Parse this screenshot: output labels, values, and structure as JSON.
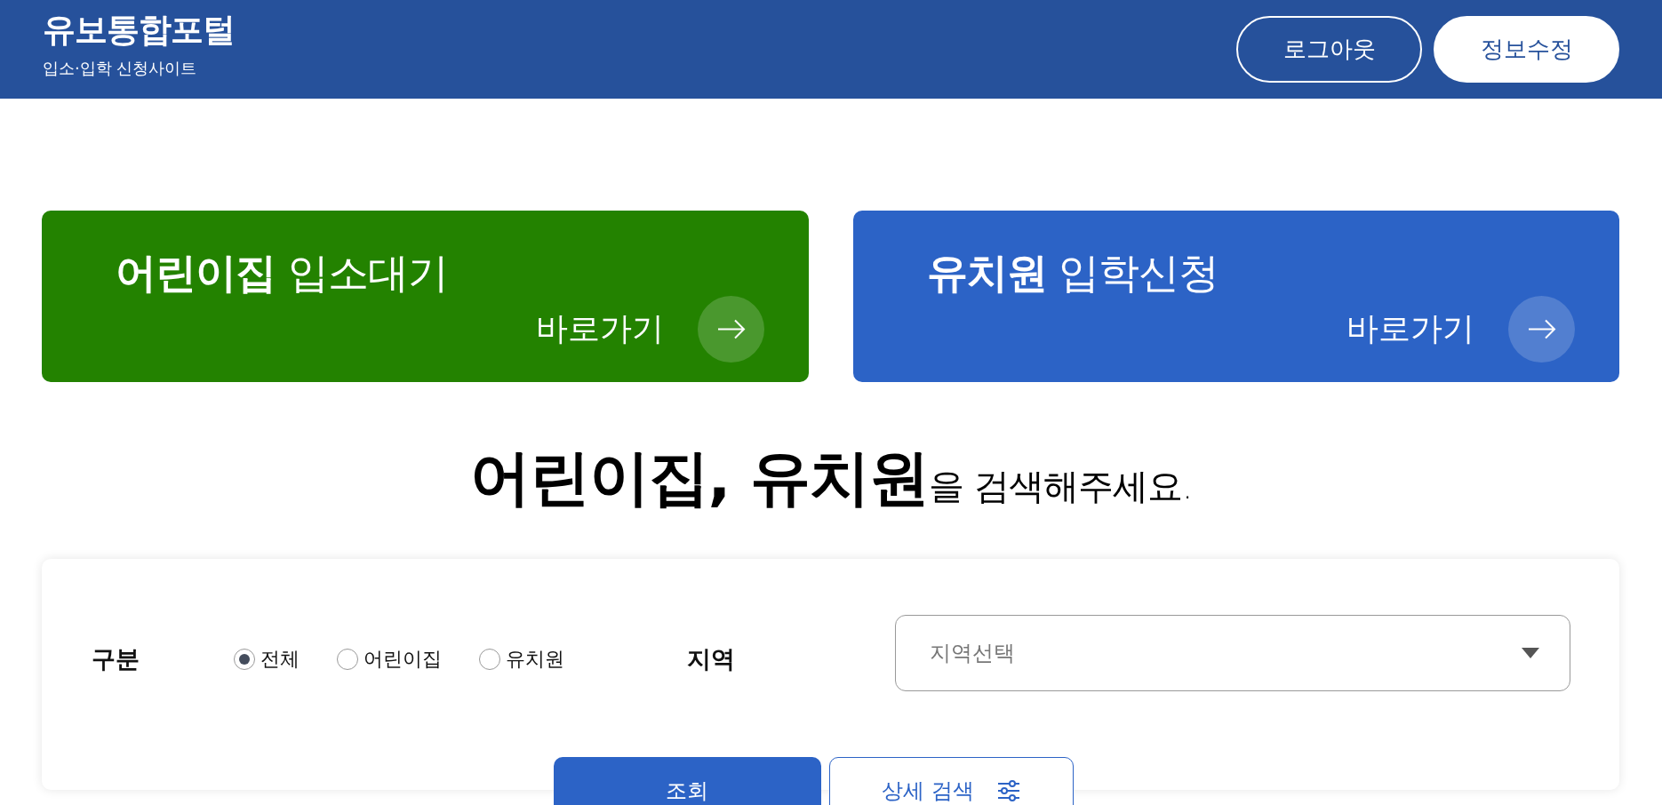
{
  "header": {
    "title": "유보통합포털",
    "subtitle": "입소·입학 신청사이트",
    "buttons": [
      {
        "label": "로그아웃",
        "kind": "outline"
      },
      {
        "label": "정보수정",
        "kind": "filled"
      }
    ]
  },
  "cards": [
    {
      "title": "**어린이집** 입소대기",
      "link": "바로가기",
      "color": "#238200"
    },
    {
      "title": "**유치원** 입학신청",
      "link": "바로가기",
      "color": "#2c63c6"
    }
  ],
  "heading": "**어린이집, 유치원**을 검색해주세요.",
  "search": {
    "type_label": "구분",
    "options": [
      {
        "label": "전체",
        "selected": true
      },
      {
        "label": "어린이집",
        "selected": false
      },
      {
        "label": "유치원",
        "selected": false
      }
    ],
    "region_label": "지역",
    "region_select": {
      "placeholder": "지역선택"
    },
    "buttons": [
      {
        "label": "조회",
        "kind": "primary"
      },
      {
        "label": "상세 검색",
        "kind": "secondary"
      }
    ]
  }
}
